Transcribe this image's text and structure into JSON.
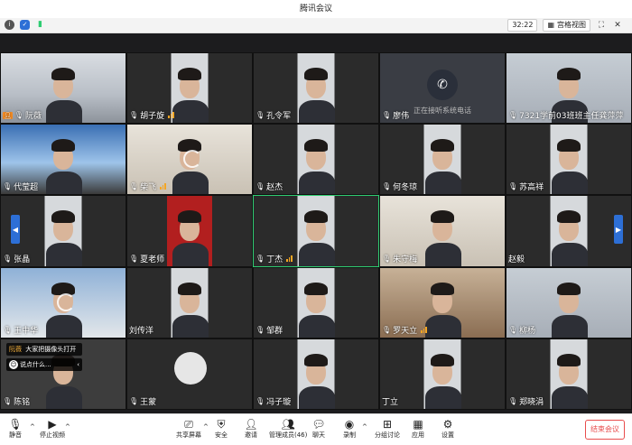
{
  "window": {
    "title": "腾讯会议"
  },
  "topbar": {
    "timer": "32:22",
    "view_label": "宫格视图"
  },
  "tiles": [
    {
      "name": "阮薇",
      "bg": "bg-room",
      "host": true
    },
    {
      "name": "胡子旋",
      "bg": "bg-split",
      "signal": true
    },
    {
      "name": "孔令军",
      "bg": "bg-split"
    },
    {
      "name": "廖伟",
      "bg": "bg-phone",
      "phone": true,
      "phone_text": "正在接听系统电话"
    },
    {
      "name": "7321学前03班班主任龚萍萍",
      "bg": "bg-room2"
    },
    {
      "name": "代莹超",
      "bg": "bg-sky"
    },
    {
      "name": "柴飞",
      "bg": "bg-warm",
      "signal": true,
      "spinner": true
    },
    {
      "name": "赵杰",
      "bg": "bg-split"
    },
    {
      "name": "何冬琼",
      "bg": "bg-split"
    },
    {
      "name": "苏高祥",
      "bg": "bg-split"
    },
    {
      "name": "张晶",
      "bg": "bg-split"
    },
    {
      "name": "夏老师",
      "bg": "bg-red"
    },
    {
      "name": "丁杰",
      "bg": "bg-split",
      "signal": true,
      "active": true
    },
    {
      "name": "朱守梅",
      "bg": "bg-warm"
    },
    {
      "name": "赵毅",
      "bg": "bg-split",
      "no_mic": true
    },
    {
      "name": "王中华",
      "bg": "bg-blue2",
      "spinner": true
    },
    {
      "name": "刘传洋",
      "bg": "bg-split",
      "no_mic": true
    },
    {
      "name": "邹群",
      "bg": "bg-split"
    },
    {
      "name": "罗天立",
      "bg": "bg-shelf",
      "signal": true
    },
    {
      "name": "柳杨",
      "bg": "bg-room2"
    },
    {
      "name": "陈铭",
      "bg": "bg-gray"
    },
    {
      "name": "王蒙",
      "bg": "bg-dark",
      "avatar": true
    },
    {
      "name": "冯子璇",
      "bg": "bg-split"
    },
    {
      "name": "丁立",
      "bg": "bg-split",
      "no_mic": true
    },
    {
      "name": "郑晓涓",
      "bg": "bg-split"
    }
  ],
  "chat": {
    "sender": "阮薇",
    "message": "大家把摄像头打开",
    "input_placeholder": "说点什么..."
  },
  "bottombar": {
    "mute": "静音",
    "stop_video": "停止视频",
    "share": "共享屏幕",
    "security": "安全",
    "invite": "邀请",
    "members": "管理成员(46)",
    "chat": "聊天",
    "record": "录制",
    "breakout": "分组讨论",
    "apps": "应用",
    "settings": "设置",
    "end_meeting": "结束会议"
  },
  "colors": {
    "accent": "#2d6fd6",
    "end_red": "#e84d4d",
    "signal": "#f5a623",
    "active_border": "#2ecc71"
  }
}
